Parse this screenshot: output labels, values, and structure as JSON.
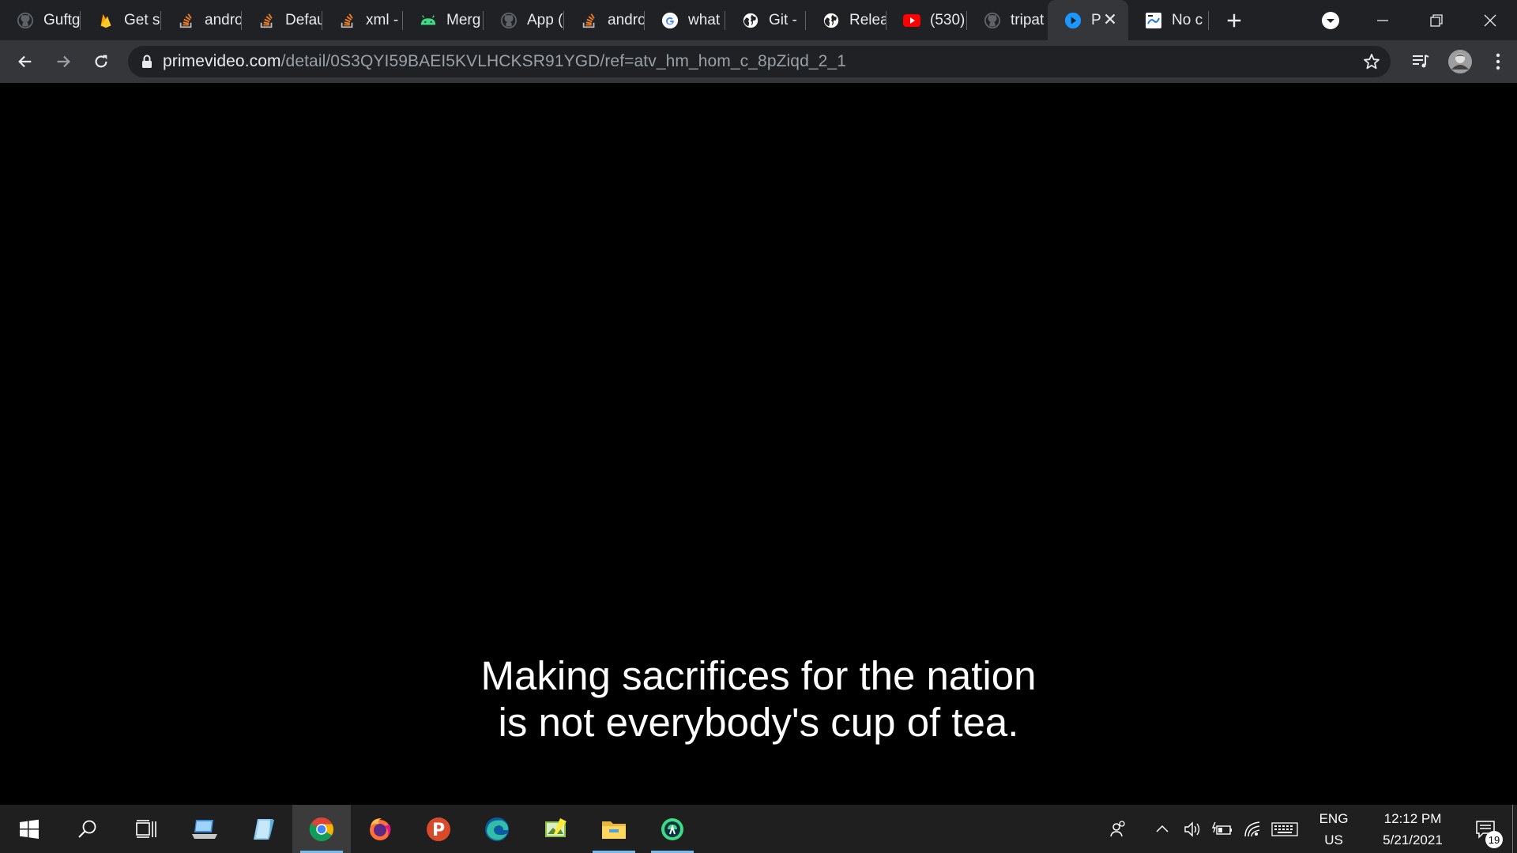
{
  "tabs": [
    {
      "label": "Guftg",
      "favicon": "github-icon"
    },
    {
      "label": "Get s",
      "favicon": "firebase-icon"
    },
    {
      "label": "andro",
      "favicon": "stackoverflow-icon"
    },
    {
      "label": "Defau",
      "favicon": "stackoverflow-icon"
    },
    {
      "label": "xml -",
      "favicon": "stackoverflow-icon"
    },
    {
      "label": "Merg",
      "favicon": "android-icon"
    },
    {
      "label": "App (",
      "favicon": "github-icon"
    },
    {
      "label": "andro",
      "favicon": "stackoverflow-icon"
    },
    {
      "label": "what",
      "favicon": "google-icon"
    },
    {
      "label": "Git -",
      "favicon": "globe-icon"
    },
    {
      "label": "Relea",
      "favicon": "globe-icon"
    },
    {
      "label": "(530)",
      "favicon": "youtube-icon"
    },
    {
      "label": "tripat",
      "favicon": "github-icon"
    },
    {
      "label": "P",
      "favicon": "primevideo-icon",
      "active": true
    },
    {
      "label": "No c",
      "favicon": "page-icon"
    }
  ],
  "address_bar": {
    "host": "primevideo.com",
    "path": "/detail/0S3QYI59BAEI5KVLHCKSR91YGD/ref=atv_hm_hom_c_8pZiqd_2_1"
  },
  "subtitle": {
    "line1": "Making sacrifices for the nation",
    "line2": "is not everybody's cup of tea."
  },
  "taskbar": {
    "apps": [
      "windows-start-icon",
      "search-icon",
      "task-view-icon",
      "laptop-icon",
      "notepad-icon",
      "chrome-icon",
      "firefox-icon",
      "postman-icon",
      "edge-icon",
      "image-editor-icon",
      "file-explorer-icon",
      "android-studio-icon"
    ],
    "lang_line1": "ENG",
    "lang_line2": "US",
    "time": "12:12 PM",
    "date": "5/21/2021",
    "notification_count": "19"
  },
  "colors": {
    "tabstrip_bg": "#202124",
    "toolbar_bg": "#35363a",
    "content_bg": "#000000",
    "taskbar_bg": "#1f1f1f",
    "taskbar_accent": "#76b9ed"
  }
}
